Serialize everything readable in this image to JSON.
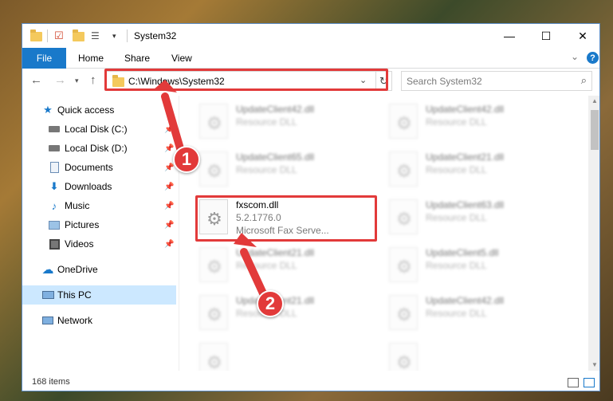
{
  "window": {
    "title": "System32",
    "controls": {
      "minimize": "—",
      "maximize": "☐",
      "close": "✕"
    }
  },
  "ribbon": {
    "file_tab": "File",
    "tabs": [
      "Home",
      "Share",
      "View"
    ],
    "help": "?"
  },
  "address": {
    "path": "C:\\Windows\\System32",
    "search_placeholder": "Search System32"
  },
  "nav_pane": {
    "items": [
      {
        "label": "Quick access",
        "icon": "star-icon",
        "pinned": false
      },
      {
        "label": "Local Disk (C:)",
        "icon": "drive-icon",
        "pinned": true
      },
      {
        "label": "Local Disk (D:)",
        "icon": "drive-icon",
        "pinned": true
      },
      {
        "label": "Documents",
        "icon": "document-icon",
        "pinned": true
      },
      {
        "label": "Downloads",
        "icon": "download-icon",
        "pinned": true
      },
      {
        "label": "Music",
        "icon": "music-icon",
        "pinned": true
      },
      {
        "label": "Pictures",
        "icon": "picture-icon",
        "pinned": true
      },
      {
        "label": "Videos",
        "icon": "video-icon",
        "pinned": true
      },
      {
        "label": "OneDrive",
        "icon": "cloud-icon",
        "pinned": false
      },
      {
        "label": "This PC",
        "icon": "pc-icon",
        "pinned": false,
        "selected": true
      },
      {
        "label": "Network",
        "icon": "network-icon",
        "pinned": false
      }
    ]
  },
  "files": {
    "highlighted": {
      "name": "fxscom.dll",
      "version": "5.2.1776.0",
      "description": "Microsoft Fax Serve..."
    },
    "blurred": [
      {
        "name": "UpdateClient42.dll",
        "type": "Resource DLL"
      },
      {
        "name": "UpdateClient42.dll",
        "type": "Resource DLL"
      },
      {
        "name": "UpdateClient65.dll",
        "type": "Resource DLL"
      },
      {
        "name": "UpdateClient21.dll",
        "type": "Resource DLL"
      },
      {
        "name": "UpdateClient63.dll",
        "type": "Resource DLL"
      },
      {
        "name": "UpdateClient21.dll",
        "type": "Resource DLL"
      },
      {
        "name": "UpdateClient5.dll",
        "type": "Resource DLL"
      },
      {
        "name": "UpdateClient21.dll",
        "type": "Resource DLL"
      },
      {
        "name": "UpdateClient42.dll",
        "type": "Resource DLL"
      }
    ]
  },
  "status": {
    "item_count": "168 items"
  },
  "callouts": {
    "one": "1",
    "two": "2"
  },
  "colors": {
    "accent": "#1979ca",
    "callout_red": "#e23a3a",
    "selected_bg": "#cce8ff"
  }
}
